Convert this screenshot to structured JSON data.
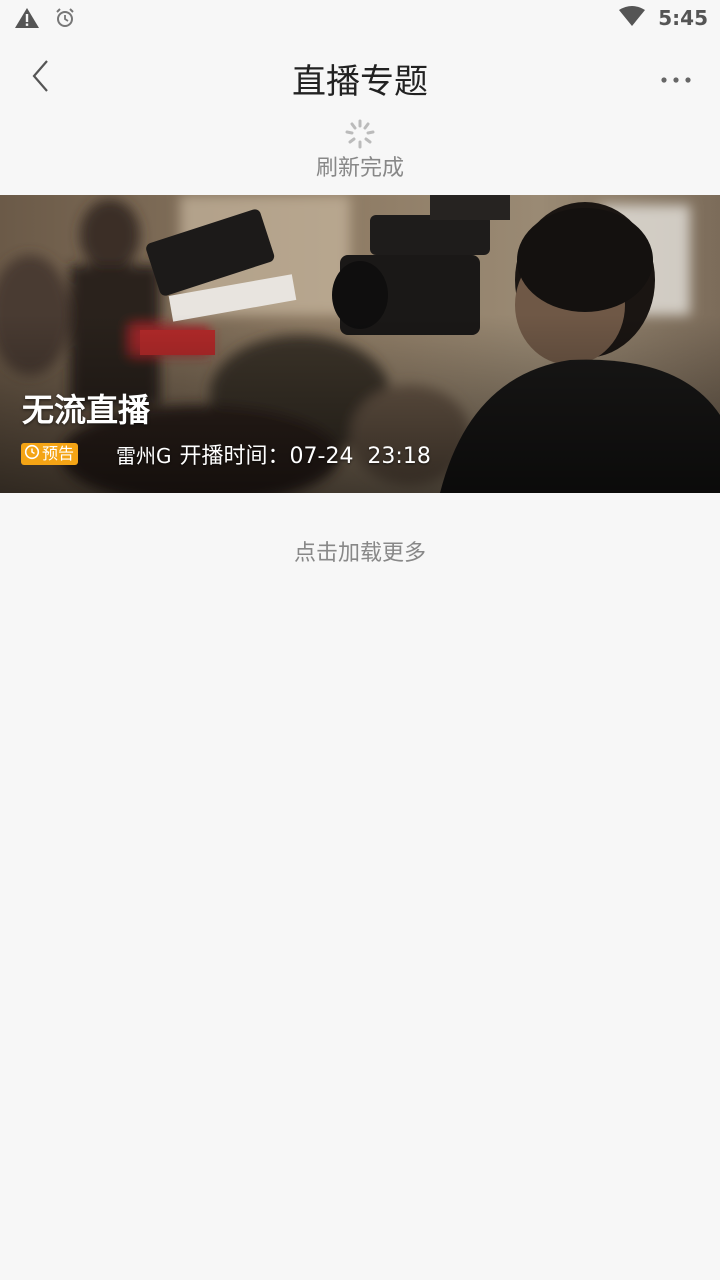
{
  "status_bar": {
    "time": "5:45",
    "icons": [
      "warning-icon",
      "alarm-icon",
      "wifi-icon"
    ]
  },
  "header": {
    "title": "直播专题",
    "back_icon": "chevron-left-icon",
    "more_icon": "more-icon"
  },
  "refresh": {
    "status_text": "刷新完成"
  },
  "live_item": {
    "title": "无流直播",
    "badge_label": "预告",
    "author": "雷州G",
    "time_label": "开播时间：",
    "time_value": "07-24  23:18",
    "badge_color": "#f4a415"
  },
  "load_more_label": "点击加载更多"
}
